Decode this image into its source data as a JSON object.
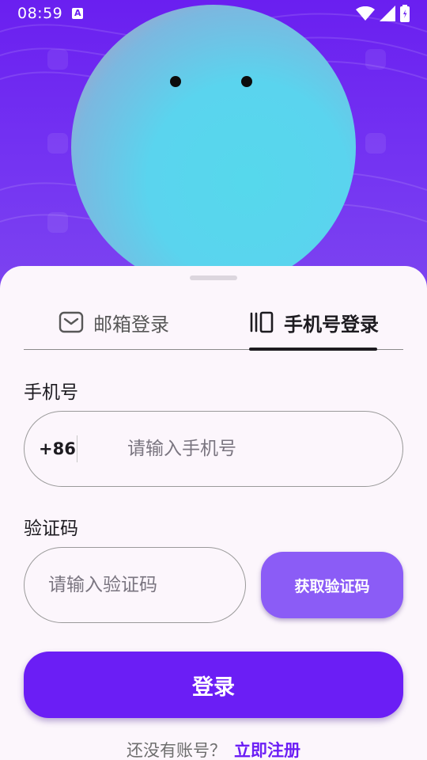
{
  "status_bar": {
    "time": "08:59",
    "notification_icon": "a-notification-icon",
    "wifi_icon": "wifi-icon",
    "signal_icon": "cell-signal-icon",
    "battery_icon": "battery-icon"
  },
  "colors": {
    "accent": "#6b1ef5",
    "get_code_button": "#8b5cf6",
    "hero_background": "#6a1ff0",
    "mascot": "#56d8ec",
    "sheet_background": "#fcf6fc"
  },
  "tabs": [
    {
      "label": "邮箱登录",
      "icon": "mail-icon",
      "selected": false
    },
    {
      "label": "手机号登录",
      "icon": "phone-icon",
      "selected": true
    }
  ],
  "phone": {
    "label": "手机号",
    "country_code": "+86",
    "placeholder": "请输入手机号",
    "value": ""
  },
  "verification": {
    "label": "验证码",
    "placeholder": "请输入验证码",
    "value": "",
    "get_code_label": "获取验证码"
  },
  "login_button_label": "登录",
  "register": {
    "prompt": "还没有账号？",
    "link": "立即注册"
  }
}
